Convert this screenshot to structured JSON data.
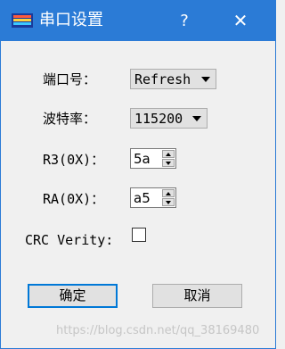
{
  "titlebar": {
    "title": "串口设置",
    "help_label": "?",
    "close_label": "✕",
    "accent_color": "#2b7bd6"
  },
  "form": {
    "port_label": "端口号：",
    "port_value": "Refresh",
    "baud_label": "波特率：",
    "baud_value": "115200",
    "r3_label": "R3(0X)：",
    "r3_value": "5a",
    "ra_label": "RA(0X)：",
    "ra_value": "a5",
    "crc_label": "CRC Verity:",
    "crc_checked": false
  },
  "buttons": {
    "ok_label": "确定",
    "cancel_label": "取消"
  },
  "watermark": "https://blog.csdn.net/qq_38169480"
}
